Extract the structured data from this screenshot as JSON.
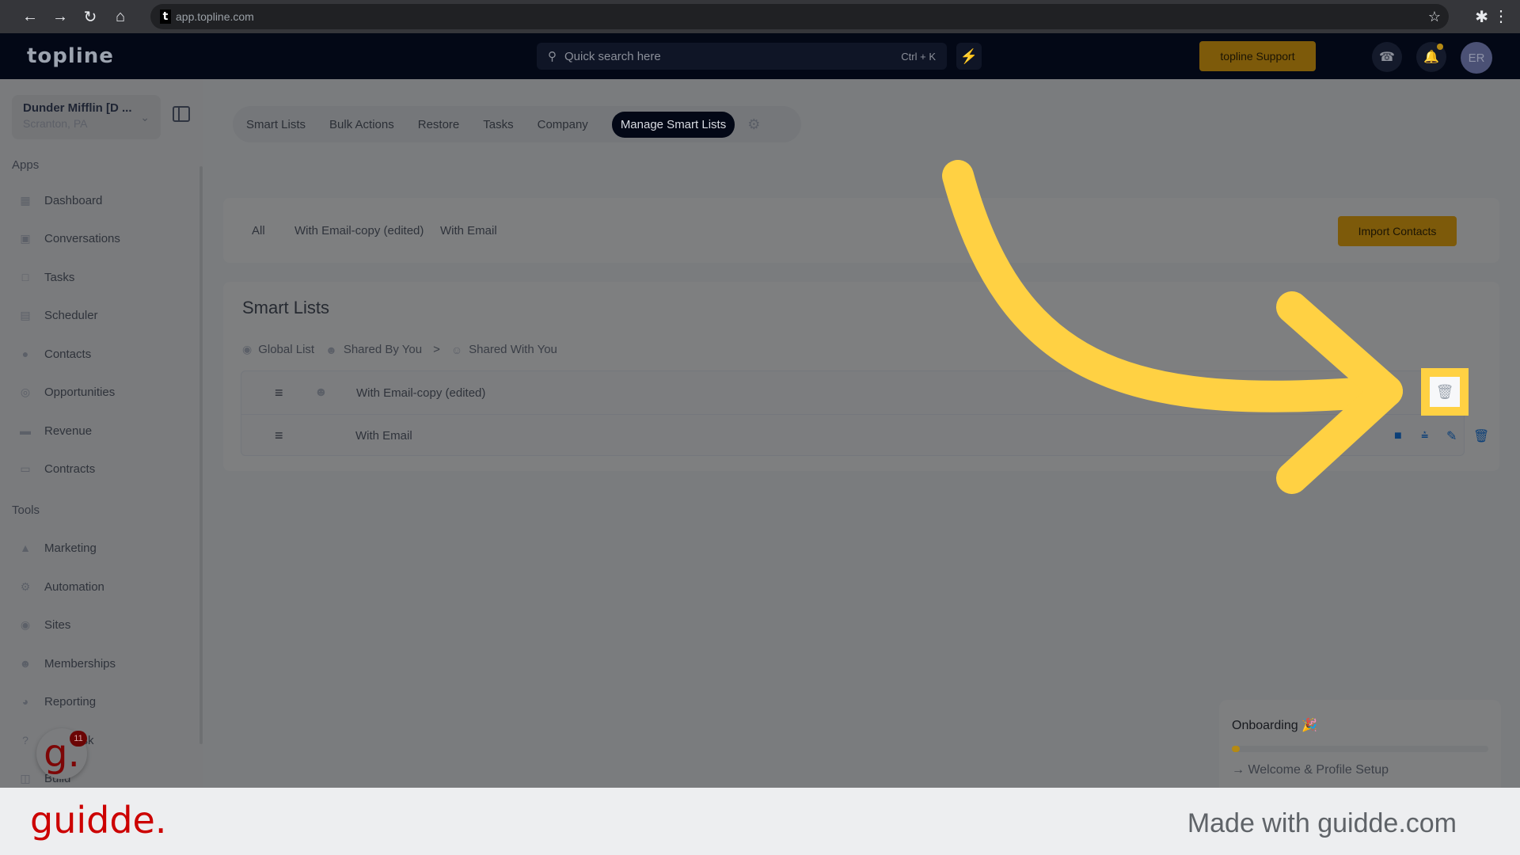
{
  "browser": {
    "url": "app.topline.com",
    "favicon_letter": "t"
  },
  "header": {
    "logo": "topline",
    "search_placeholder": "Quick search here",
    "search_shortcut": "Ctrl + K",
    "support_label": "topline Support",
    "avatar_initials": "ER"
  },
  "sidebar": {
    "location_name": "Dunder Mifflin [D ...",
    "location_sub": "Scranton, PA",
    "apps_label": "Apps",
    "apps": [
      {
        "label": "Dashboard",
        "icon": "dashboard-icon"
      },
      {
        "label": "Conversations",
        "icon": "chat-icon"
      },
      {
        "label": "Tasks",
        "icon": "task-icon"
      },
      {
        "label": "Scheduler",
        "icon": "calendar-icon"
      },
      {
        "label": "Contacts",
        "icon": "person-icon"
      },
      {
        "label": "Opportunities",
        "icon": "target-icon"
      },
      {
        "label": "Revenue",
        "icon": "card-icon"
      },
      {
        "label": "Contracts",
        "icon": "document-icon"
      }
    ],
    "tools_label": "Tools",
    "tools": [
      {
        "label": "Marketing",
        "icon": "megaphone-icon"
      },
      {
        "label": "Automation",
        "icon": "gears-icon"
      },
      {
        "label": "Sites",
        "icon": "globe-icon"
      },
      {
        "label": "Memberships",
        "icon": "members-icon"
      },
      {
        "label": "Reporting",
        "icon": "pie-icon"
      },
      {
        "label": "Helpdesk",
        "icon": "help-icon"
      },
      {
        "label": "Build",
        "icon": "build-icon"
      }
    ],
    "fab_badge": "11"
  },
  "tabs": [
    {
      "label": "Smart Lists",
      "active": false
    },
    {
      "label": "Bulk Actions",
      "active": false
    },
    {
      "label": "Restore",
      "active": false
    },
    {
      "label": "Tasks",
      "active": false
    },
    {
      "label": "Company",
      "active": false
    },
    {
      "label": "Manage Smart Lists",
      "active": true
    }
  ],
  "filters": [
    "All",
    "With Email-copy (edited)",
    "With Email"
  ],
  "import_label": "Import Contacts",
  "smart_lists": {
    "title": "Smart Lists",
    "legend": [
      {
        "label": "Global List",
        "icon": "globe-icon"
      },
      {
        "label": "Shared By You",
        "icon": "user-share-icon"
      },
      {
        "label": ">",
        "icon": ""
      },
      {
        "label": "Shared With You",
        "icon": "group-icon"
      }
    ],
    "rows": [
      {
        "name": "With Email-copy (edited)",
        "shared_by_you": true
      },
      {
        "name": "With Email",
        "shared_by_you": false
      }
    ]
  },
  "onboarding": {
    "title": "Onboarding",
    "progress_percent": 3,
    "step": "Welcome & Profile Setup"
  },
  "footer": {
    "brand": "guidde.",
    "made_with": "Made with guidde.com"
  },
  "colors": {
    "accent_yellow": "#ffd143",
    "action_blue": "#0b3f78",
    "brand_red": "#cc0000",
    "header_dark": "#030816"
  }
}
